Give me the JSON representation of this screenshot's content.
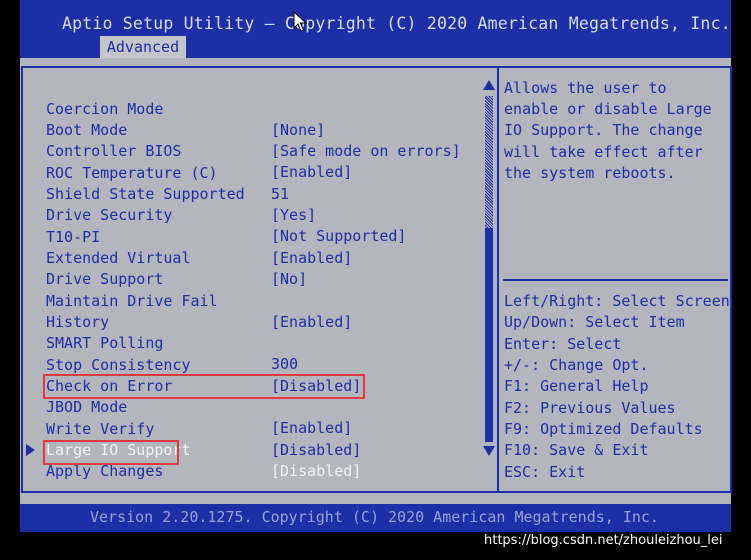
{
  "header": {
    "title": "Aptio Setup Utility – Copyright (C) 2020 American Megatrends, Inc.",
    "active_tab": "Advanced"
  },
  "colors": {
    "header_bg": "#1c2fa6",
    "panel_bg": "#b4b6bd",
    "text": "#1c2fa6",
    "selected_text": "#f2f3f7",
    "highlight_box": "#e0393e"
  },
  "settings": [
    {
      "label": "Coercion Mode",
      "value": "[None]"
    },
    {
      "label": "Boot Mode",
      "value": "[Safe mode on errors]"
    },
    {
      "label": "Controller BIOS",
      "value": "[Enabled]"
    },
    {
      "label": "ROC Temperature (C)",
      "value": "51"
    },
    {
      "label": "Shield State Supported",
      "value": "[Yes]"
    },
    {
      "label": "Drive Security",
      "value": "[Not Supported]"
    },
    {
      "label": "T10-PI",
      "value": "[Enabled]"
    },
    {
      "label": "Extended Virtual",
      "value": "[No]"
    },
    {
      "label": "Drive Support",
      "value": ""
    },
    {
      "label": "Maintain Drive Fail",
      "value": "[Enabled]"
    },
    {
      "label": "History",
      "value": ""
    },
    {
      "label": "SMART Polling",
      "value": "300"
    },
    {
      "label": "Stop Consistency",
      "value": "[Disabled]"
    },
    {
      "label": "Check on Error",
      "value": ""
    },
    {
      "label": "JBOD Mode",
      "value": "[Enabled]"
    },
    {
      "label": "Write Verify",
      "value": "[Disabled]"
    },
    {
      "label": "Large IO Support",
      "value": "[Disabled]"
    },
    {
      "label": "Apply Changes",
      "value": ""
    }
  ],
  "help": {
    "description": [
      "Allows the user to",
      "enable or disable Large",
      "IO Support. The change",
      "will take effect after",
      "the system reboots."
    ],
    "keys": [
      "Left/Right: Select Screen",
      "Up/Down: Select Item",
      "Enter: Select",
      "+/-: Change Opt.",
      "F1: General Help",
      "F2: Previous Values",
      "F9: Optimized Defaults",
      "F10: Save & Exit",
      "ESC: Exit"
    ]
  },
  "footer": {
    "version": "Version 2.20.1275. Copyright (C) 2020 American Megatrends, Inc."
  },
  "watermark": "https://blog.csdn.net/zhouleizhou_lei"
}
